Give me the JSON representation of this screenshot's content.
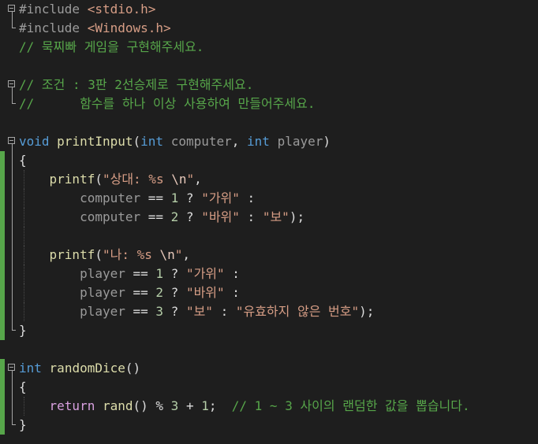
{
  "editor": {
    "lines": [
      {
        "segments": [
          {
            "t": "#include ",
            "c": "pp"
          },
          {
            "t": "<stdio.h>",
            "c": "inc"
          }
        ],
        "fold": "open"
      },
      {
        "segments": [
          {
            "t": "#include ",
            "c": "pp"
          },
          {
            "t": "<Windows.h>",
            "c": "inc"
          }
        ],
        "fold": "end"
      },
      {
        "segments": [
          {
            "t": "// 묵찌빠 게임을 구현해주세요.",
            "c": "cm"
          }
        ]
      },
      {
        "segments": []
      },
      {
        "segments": [
          {
            "t": "// 조건 : 3판 2선승제로 구현해주세요.",
            "c": "cm"
          }
        ],
        "fold": "open"
      },
      {
        "segments": [
          {
            "t": "//      함수를 하나 이상 사용하여 만들어주세요.",
            "c": "cm"
          }
        ],
        "fold": "end"
      },
      {
        "segments": []
      },
      {
        "segments": [
          {
            "t": "void",
            "c": "kw"
          },
          {
            "t": " ",
            "c": "pn"
          },
          {
            "t": "printInput",
            "c": "fn"
          },
          {
            "t": "(",
            "c": "pn"
          },
          {
            "t": "int",
            "c": "kw"
          },
          {
            "t": " ",
            "c": "pn"
          },
          {
            "t": "computer",
            "c": "prm"
          },
          {
            "t": ", ",
            "c": "pn"
          },
          {
            "t": "int",
            "c": "kw"
          },
          {
            "t": " ",
            "c": "pn"
          },
          {
            "t": "player",
            "c": "prm"
          },
          {
            "t": ")",
            "c": "pn"
          }
        ],
        "fold": "open"
      },
      {
        "segments": [
          {
            "t": "{",
            "c": "pn"
          }
        ],
        "bar": true,
        "guide": false
      },
      {
        "segments": [
          {
            "t": "    ",
            "c": "pn"
          },
          {
            "t": "printf",
            "c": "fn"
          },
          {
            "t": "(",
            "c": "pn"
          },
          {
            "t": "\"상대: %s ",
            "c": "str"
          },
          {
            "t": "\\n",
            "c": "esc"
          },
          {
            "t": "\"",
            "c": "str"
          },
          {
            "t": ",",
            "c": "pn"
          }
        ],
        "bar": true,
        "guide": true
      },
      {
        "segments": [
          {
            "t": "        ",
            "c": "pn"
          },
          {
            "t": "computer",
            "c": "prm"
          },
          {
            "t": " == ",
            "c": "pn"
          },
          {
            "t": "1",
            "c": "num"
          },
          {
            "t": " ? ",
            "c": "pn"
          },
          {
            "t": "\"가위\"",
            "c": "str"
          },
          {
            "t": " :",
            "c": "pn"
          }
        ],
        "bar": true,
        "guide": true
      },
      {
        "segments": [
          {
            "t": "        ",
            "c": "pn"
          },
          {
            "t": "computer",
            "c": "prm"
          },
          {
            "t": " == ",
            "c": "pn"
          },
          {
            "t": "2",
            "c": "num"
          },
          {
            "t": " ? ",
            "c": "pn"
          },
          {
            "t": "\"바위\"",
            "c": "str"
          },
          {
            "t": " : ",
            "c": "pn"
          },
          {
            "t": "\"보\"",
            "c": "str"
          },
          {
            "t": ");",
            "c": "pn"
          }
        ],
        "bar": true,
        "guide": true
      },
      {
        "segments": [],
        "bar": true,
        "guide": true
      },
      {
        "segments": [
          {
            "t": "    ",
            "c": "pn"
          },
          {
            "t": "printf",
            "c": "fn"
          },
          {
            "t": "(",
            "c": "pn"
          },
          {
            "t": "\"나: %s ",
            "c": "str"
          },
          {
            "t": "\\n",
            "c": "esc"
          },
          {
            "t": "\"",
            "c": "str"
          },
          {
            "t": ",",
            "c": "pn"
          }
        ],
        "bar": true,
        "guide": true
      },
      {
        "segments": [
          {
            "t": "        ",
            "c": "pn"
          },
          {
            "t": "player",
            "c": "prm"
          },
          {
            "t": " == ",
            "c": "pn"
          },
          {
            "t": "1",
            "c": "num"
          },
          {
            "t": " ? ",
            "c": "pn"
          },
          {
            "t": "\"가위\"",
            "c": "str"
          },
          {
            "t": " :",
            "c": "pn"
          }
        ],
        "bar": true,
        "guide": true
      },
      {
        "segments": [
          {
            "t": "        ",
            "c": "pn"
          },
          {
            "t": "player",
            "c": "prm"
          },
          {
            "t": " == ",
            "c": "pn"
          },
          {
            "t": "2",
            "c": "num"
          },
          {
            "t": " ? ",
            "c": "pn"
          },
          {
            "t": "\"바위\"",
            "c": "str"
          },
          {
            "t": " :",
            "c": "pn"
          }
        ],
        "bar": true,
        "guide": true
      },
      {
        "segments": [
          {
            "t": "        ",
            "c": "pn"
          },
          {
            "t": "player",
            "c": "prm"
          },
          {
            "t": " == ",
            "c": "pn"
          },
          {
            "t": "3",
            "c": "num"
          },
          {
            "t": " ? ",
            "c": "pn"
          },
          {
            "t": "\"보\"",
            "c": "str"
          },
          {
            "t": " : ",
            "c": "pn"
          },
          {
            "t": "\"유효하지 않은 번호\"",
            "c": "str"
          },
          {
            "t": ");",
            "c": "pn"
          }
        ],
        "bar": true,
        "guide": true
      },
      {
        "segments": [
          {
            "t": "}",
            "c": "pn"
          }
        ],
        "bar": true,
        "fold": "end"
      },
      {
        "segments": []
      },
      {
        "segments": [
          {
            "t": "int",
            "c": "kw"
          },
          {
            "t": " ",
            "c": "pn"
          },
          {
            "t": "randomDice",
            "c": "fn"
          },
          {
            "t": "()",
            "c": "pn"
          }
        ],
        "fold": "open",
        "bar": true
      },
      {
        "segments": [
          {
            "t": "{",
            "c": "pn"
          }
        ],
        "bar": true
      },
      {
        "segments": [
          {
            "t": "    ",
            "c": "pn"
          },
          {
            "t": "return",
            "c": "ctl"
          },
          {
            "t": " ",
            "c": "pn"
          },
          {
            "t": "rand",
            "c": "fn"
          },
          {
            "t": "() % ",
            "c": "pn"
          },
          {
            "t": "3",
            "c": "num"
          },
          {
            "t": " + ",
            "c": "pn"
          },
          {
            "t": "1",
            "c": "num"
          },
          {
            "t": ";  ",
            "c": "pn"
          },
          {
            "t": "// 1 ~ 3 사이의 랜덤한 값을 뽑습니다.",
            "c": "cm"
          }
        ],
        "bar": true,
        "guide": true
      },
      {
        "segments": [
          {
            "t": "}",
            "c": "pn"
          }
        ],
        "bar": true,
        "fold": "end"
      }
    ]
  }
}
